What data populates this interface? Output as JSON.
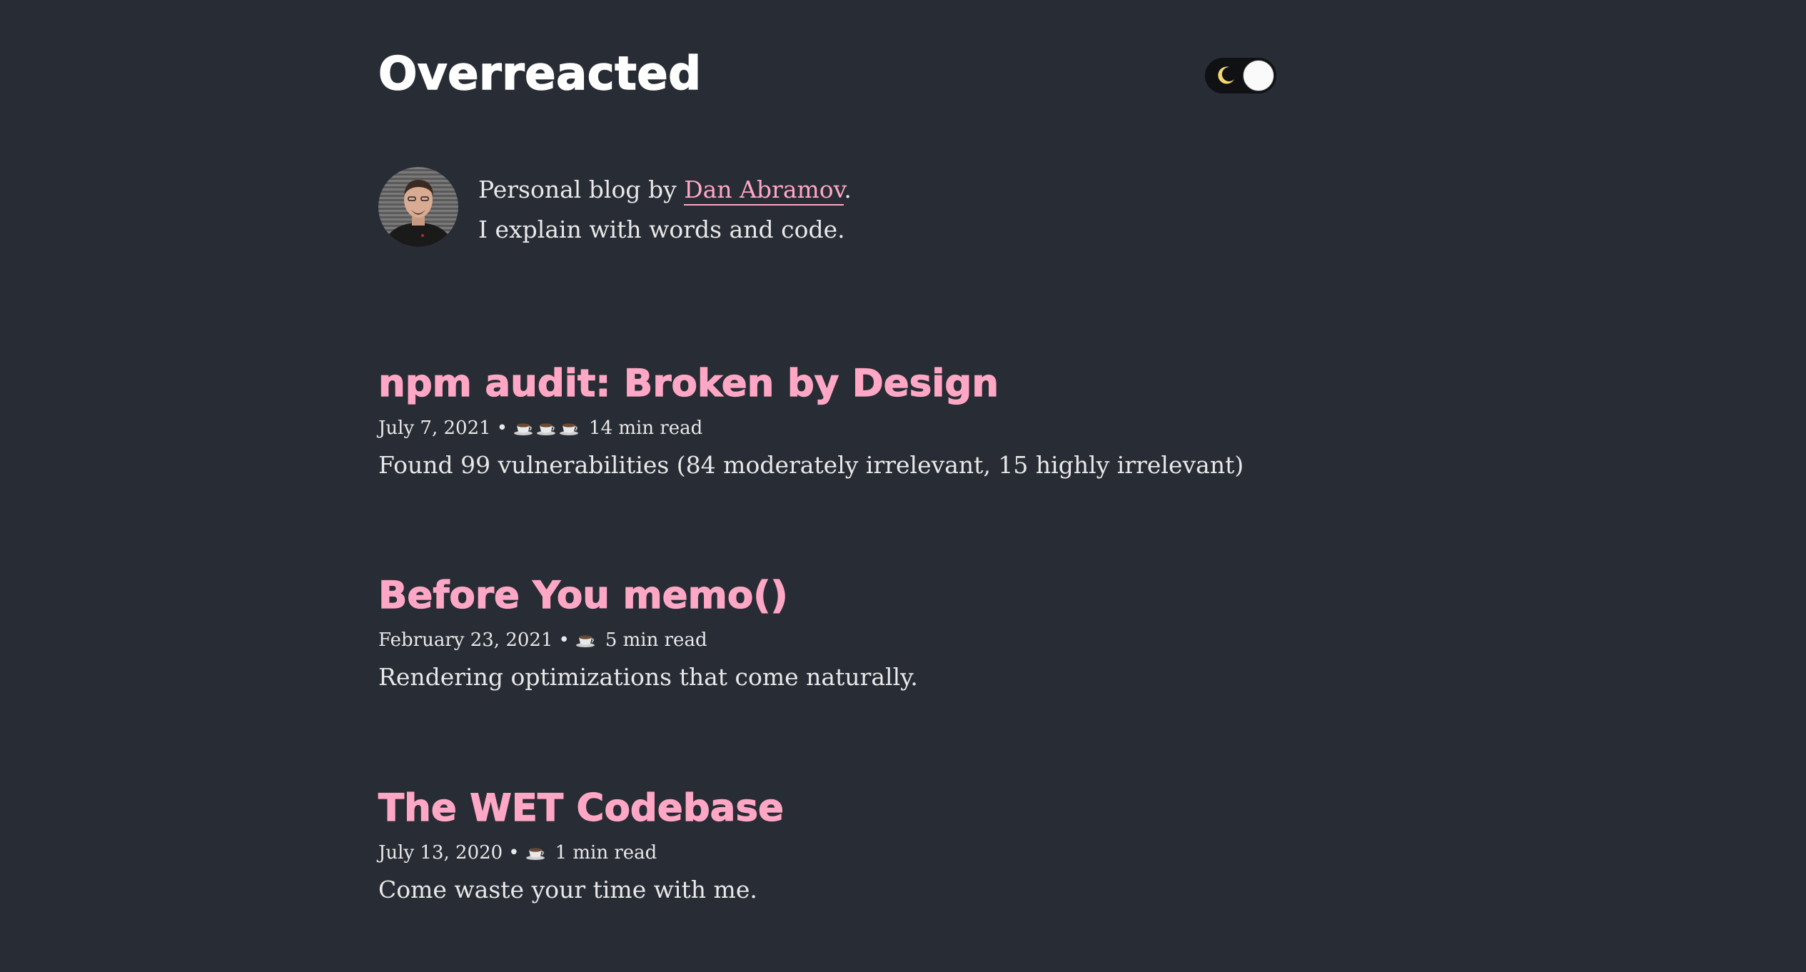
{
  "header": {
    "site_title": "Overreacted",
    "theme_toggle_icon": "moon-icon"
  },
  "bio": {
    "avatar_icon": "avatar",
    "line1_prefix": "Personal blog by ",
    "author_link": "Dan Abramov",
    "line1_suffix": ".",
    "line2": "I explain with words and code."
  },
  "posts": [
    {
      "title": "npm audit: Broken by Design",
      "date": "July 7, 2021",
      "separator": "•",
      "read_icon": "coffee-cup-icon",
      "read_icon_count": 3,
      "read_time": "14 min read",
      "excerpt": "Found 99 vulnerabilities (84 moderately irrelevant, 15 highly irrelevant)"
    },
    {
      "title": "Before You memo()",
      "date": "February 23, 2021",
      "separator": "•",
      "read_icon": "coffee-cup-icon",
      "read_icon_count": 1,
      "read_time": "5 min read",
      "excerpt": "Rendering optimizations that come naturally."
    },
    {
      "title": "The WET Codebase",
      "date": "July 13, 2020",
      "separator": "•",
      "read_icon": "coffee-cup-icon",
      "read_icon_count": 1,
      "read_time": "1 min read",
      "excerpt": "Come waste your time with me."
    }
  ],
  "colors": {
    "background": "#282c35",
    "accent": "#ffa7c4",
    "text": "#e8e8e8",
    "title": "#ffffff"
  }
}
